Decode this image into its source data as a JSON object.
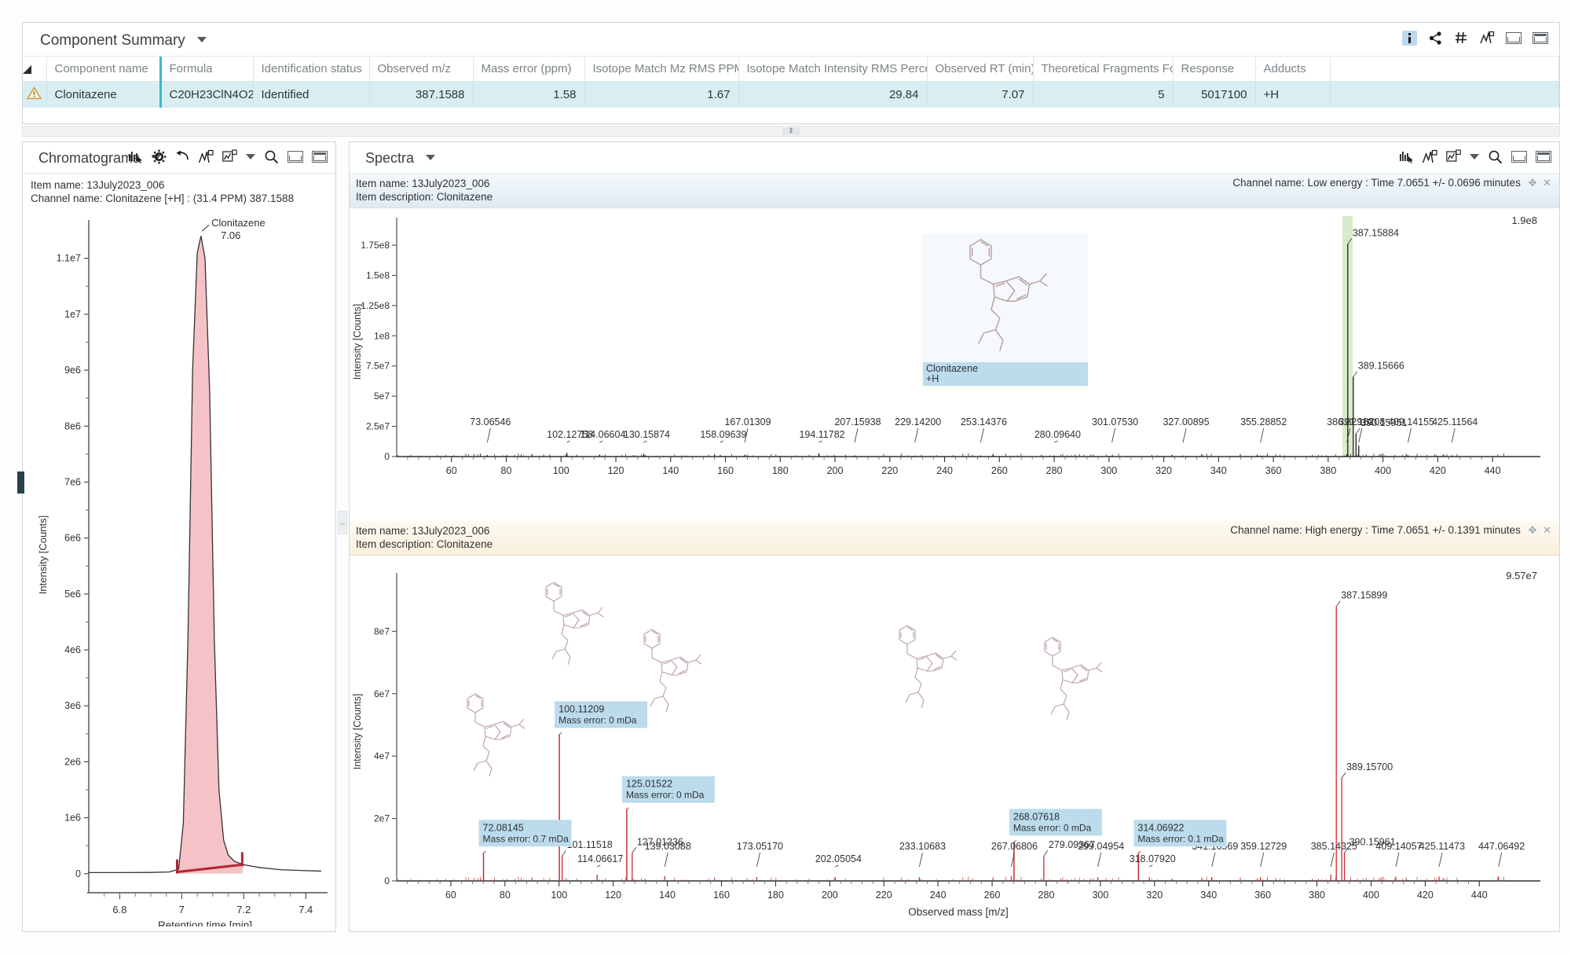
{
  "component_summary": {
    "title": "Component Summary",
    "columns": [
      {
        "label": "Component name",
        "align": "left"
      },
      {
        "label": "Formula",
        "align": "left"
      },
      {
        "label": "Identification status",
        "align": "left"
      },
      {
        "label": "Observed m/z",
        "align": "right"
      },
      {
        "label": "Mass error (ppm)",
        "align": "right"
      },
      {
        "label": "Isotope Match Mz RMS PPM",
        "align": "right"
      },
      {
        "label": "Isotope Match Intensity RMS Percent",
        "align": "right"
      },
      {
        "label": "Observed RT (min)",
        "align": "right"
      },
      {
        "label": "Theoretical Fragments Found",
        "align": "right"
      },
      {
        "label": "Response",
        "align": "right"
      },
      {
        "label": "Adducts",
        "align": "left"
      },
      {
        "label": "",
        "align": "left"
      }
    ],
    "rows": [
      {
        "component_name": "Clonitazene",
        "formula": "C20H23ClN4O2",
        "identification_status": "Identified",
        "observed_mz": "387.1588",
        "mass_error_ppm": "1.58",
        "isotope_match_mz_rms_ppm": "1.67",
        "isotope_match_intensity_rms_percent": "29.84",
        "observed_rt_min": "7.07",
        "theoretical_fragments_found": "5",
        "response": "5017100",
        "adducts": "+H",
        "extra": ""
      }
    ],
    "toolbar_icons": [
      "info-icon",
      "share-icon",
      "hash-icon",
      "peak-pick-icon",
      "restore-window-icon",
      "maximize-window-icon"
    ]
  },
  "chromatograms": {
    "title": "Chromatograms",
    "toolbar_icons": [
      "bar-pick-icon",
      "gear-icon",
      "undo-icon",
      "peak-annotate-icon",
      "chart-type-icon",
      "chevron-down-icon",
      "zoom-icon",
      "restore-window-icon",
      "maximize-window-icon"
    ],
    "item_name": "Item name: 13July2023_006",
    "channel_name": "Channel name: Clonitazene [+H] : (31.4 PPM) 387.1588",
    "peak_label": "Clonitazene",
    "peak_rt": "7.06",
    "chart_data": {
      "type": "line",
      "title": "Clonitazene [+H] : (31.4 PPM) 387.1588",
      "xlabel": "Retention time [min]",
      "ylabel": "Intensity [Counts]",
      "xlim": [
        6.7,
        7.45
      ],
      "ylim": [
        -200000,
        11600000
      ],
      "xticks": [
        "6.8",
        "7",
        "7.2",
        "7.4"
      ],
      "xtickvals": [
        6.8,
        7.0,
        7.2,
        7.4
      ],
      "yticks": [
        "0",
        "1e6",
        "2e6",
        "3e6",
        "4e6",
        "5e6",
        "6e6",
        "7e6",
        "8e6",
        "9e6",
        "1e7",
        "1.1e7"
      ],
      "ytickvals": [
        0,
        1000000,
        2000000,
        3000000,
        4000000,
        5000000,
        6000000,
        7000000,
        8000000,
        9000000,
        10000000,
        11000000
      ],
      "peak_apex_x": 7.06,
      "peak_apex_y": 11400000,
      "integration_start": 6.985,
      "integration_end": 7.195,
      "fill_color": "#f3b8bd",
      "line_color": "#333333",
      "baseline_color": "#b12732",
      "trace": [
        {
          "x": 6.7,
          "y": 20000
        },
        {
          "x": 6.8,
          "y": 20000
        },
        {
          "x": 6.9,
          "y": 22000
        },
        {
          "x": 6.96,
          "y": 30000
        },
        {
          "x": 6.99,
          "y": 80000
        },
        {
          "x": 7.005,
          "y": 900000
        },
        {
          "x": 7.02,
          "y": 4200000
        },
        {
          "x": 7.035,
          "y": 9000000
        },
        {
          "x": 7.05,
          "y": 11100000
        },
        {
          "x": 7.062,
          "y": 11400000
        },
        {
          "x": 7.075,
          "y": 11000000
        },
        {
          "x": 7.09,
          "y": 8600000
        },
        {
          "x": 7.105,
          "y": 4200000
        },
        {
          "x": 7.12,
          "y": 1500000
        },
        {
          "x": 7.135,
          "y": 600000
        },
        {
          "x": 7.15,
          "y": 330000
        },
        {
          "x": 7.17,
          "y": 220000
        },
        {
          "x": 7.2,
          "y": 160000
        },
        {
          "x": 7.25,
          "y": 110000
        },
        {
          "x": 7.32,
          "y": 70000
        },
        {
          "x": 7.45,
          "y": 45000
        }
      ]
    }
  },
  "spectra": {
    "title": "Spectra",
    "toolbar_icons": [
      "bar-pick-icon",
      "peak-annotate-icon",
      "chart-type-icon",
      "chevron-down-icon",
      "zoom-icon",
      "restore-window-icon",
      "maximize-window-icon"
    ],
    "low_energy": {
      "item_name": "Item name: 13July2023_006",
      "item_description": "Item description: Clonitazene",
      "channel_name": "Channel name: Low energy : Time 7.0651 +/- 0.0696 minutes",
      "max_intensity_label": "1.9e8",
      "structure_caption_name": "Clonitazene",
      "structure_caption_adduct": "+H",
      "highlight_color": "#d9ecc9",
      "chart_data": {
        "type": "bar",
        "xlabel": "",
        "ylabel": "Intensity [Counts]",
        "xlim": [
          40,
          450
        ],
        "ylim": [
          0,
          190000000
        ],
        "xticks": [
          "60",
          "80",
          "100",
          "120",
          "140",
          "160",
          "180",
          "200",
          "220",
          "240",
          "260",
          "280",
          "300",
          "320",
          "340",
          "360",
          "380",
          "400",
          "420",
          "440"
        ],
        "xtickvals": [
          60,
          80,
          100,
          120,
          140,
          160,
          180,
          200,
          220,
          240,
          260,
          280,
          300,
          320,
          340,
          360,
          380,
          400,
          420,
          440
        ],
        "yticks": [
          "0",
          "2.5e7",
          "5e7",
          "7.5e7",
          "1e8",
          "1.25e8",
          "1.5e8",
          "1.75e8"
        ],
        "ytickvals": [
          0,
          25000000,
          50000000,
          75000000,
          100000000,
          125000000,
          150000000,
          175000000
        ],
        "labeled_peaks": [
          {
            "mz": "73.06546",
            "x": 73.06546,
            "y": 1200000
          },
          {
            "mz": "102.12758",
            "x": 102.12758,
            "y": 3000000
          },
          {
            "mz": "114.06604",
            "x": 114.06604,
            "y": 1500000
          },
          {
            "mz": "130.15874",
            "x": 130.15874,
            "y": 2400000
          },
          {
            "mz": "158.09639",
            "x": 158.09639,
            "y": 1200000
          },
          {
            "mz": "167.01309",
            "x": 167.01309,
            "y": 1400000
          },
          {
            "mz": "194.11782",
            "x": 194.11782,
            "y": 2600000
          },
          {
            "mz": "207.15938",
            "x": 207.15938,
            "y": 900000
          },
          {
            "mz": "229.14200",
            "x": 229.142,
            "y": 800000
          },
          {
            "mz": "253.14376",
            "x": 253.14376,
            "y": 900000
          },
          {
            "mz": "280.09640",
            "x": 280.0964,
            "y": 900000
          },
          {
            "mz": "301.07530",
            "x": 301.0753,
            "y": 800000
          },
          {
            "mz": "327.00895",
            "x": 327.00895,
            "y": 800000
          },
          {
            "mz": "355.28852",
            "x": 355.28852,
            "y": 800000
          },
          {
            "mz": "386.82910",
            "x": 386.8291,
            "y": 2000000
          },
          {
            "mz": "387.15884",
            "x": 387.15884,
            "y": 176000000
          },
          {
            "mz": "389.15666",
            "x": 389.15666,
            "y": 66000000
          },
          {
            "mz": "390.15951",
            "x": 390.15951,
            "y": 19000000
          },
          {
            "mz": "391.16208",
            "x": 391.16208,
            "y": 9000000
          },
          {
            "mz": "409.14155",
            "x": 409.14155,
            "y": 1000000
          },
          {
            "mz": "425.11564",
            "x": 425.11564,
            "y": 1000000
          }
        ],
        "highlight_band": {
          "from": 385.2,
          "to": 389.0
        }
      }
    },
    "high_energy": {
      "item_name": "Item name: 13July2023_006",
      "item_description": "Item description: Clonitazene",
      "channel_name": "Channel name: High energy : Time 7.0651 +/- 0.1391 minutes",
      "max_intensity_label": "9.57e7",
      "chart_data": {
        "type": "bar",
        "xlabel": "Observed mass [m/z]",
        "ylabel": "Intensity [Counts]",
        "xlim": [
          40,
          455
        ],
        "ylim": [
          0,
          95700000
        ],
        "xticks": [
          "60",
          "80",
          "100",
          "120",
          "140",
          "160",
          "180",
          "200",
          "220",
          "240",
          "260",
          "280",
          "300",
          "320",
          "340",
          "360",
          "380",
          "400",
          "420",
          "440"
        ],
        "xtickvals": [
          60,
          80,
          100,
          120,
          140,
          160,
          180,
          200,
          220,
          240,
          260,
          280,
          300,
          320,
          340,
          360,
          380,
          400,
          420,
          440
        ],
        "yticks": [
          "0",
          "2e7",
          "4e7",
          "6e7",
          "8e7"
        ],
        "ytickvals": [
          0,
          20000000,
          40000000,
          60000000,
          80000000
        ],
        "annotated_fragments": [
          {
            "mz": "72.08145",
            "x": 72.08145,
            "y": 9000000,
            "mass_error": "Mass error: 0.7 mDa"
          },
          {
            "mz": "100.11209",
            "x": 100.11209,
            "y": 47000000,
            "mass_error": "Mass error: 0 mDa"
          },
          {
            "mz": "125.01522",
            "x": 125.01522,
            "y": 23000000,
            "mass_error": "Mass error: 0 mDa"
          },
          {
            "mz": "268.07618",
            "x": 268.07618,
            "y": 12500000,
            "mass_error": "Mass error: 0 mDa"
          },
          {
            "mz": "314.06922",
            "x": 314.06922,
            "y": 9000000,
            "mass_error": "Mass error: 0.1 mDa"
          }
        ],
        "labeled_peaks": [
          {
            "mz": "101.11518",
            "x": 101.11518,
            "y": 8000000
          },
          {
            "mz": "114.06617",
            "x": 114.06617,
            "y": 2000000
          },
          {
            "mz": "127.01236",
            "x": 127.01236,
            "y": 9000000
          },
          {
            "mz": "139.03088",
            "x": 139.03088,
            "y": 1500000
          },
          {
            "mz": "173.05170",
            "x": 173.0517,
            "y": 1200000
          },
          {
            "mz": "202.05054",
            "x": 202.05054,
            "y": 1200000
          },
          {
            "mz": "233.10683",
            "x": 233.10683,
            "y": 1200000
          },
          {
            "mz": "267.06806",
            "x": 267.06806,
            "y": 1600000
          },
          {
            "mz": "279.09367",
            "x": 279.09367,
            "y": 8000000
          },
          {
            "mz": "299.04954",
            "x": 299.04954,
            "y": 1200000
          },
          {
            "mz": "318.07920",
            "x": 318.0792,
            "y": 1200000
          },
          {
            "mz": "341.16569",
            "x": 341.16569,
            "y": 1200000
          },
          {
            "mz": "359.12729",
            "x": 359.12729,
            "y": 1200000
          },
          {
            "mz": "385.14325",
            "x": 385.14325,
            "y": 2000000
          },
          {
            "mz": "387.15899",
            "x": 387.15899,
            "y": 88000000
          },
          {
            "mz": "389.15700",
            "x": 389.157,
            "y": 33000000
          },
          {
            "mz": "390.15961",
            "x": 390.15961,
            "y": 9000000
          },
          {
            "mz": "409.14057",
            "x": 409.14057,
            "y": 1400000
          },
          {
            "mz": "425.11473",
            "x": 425.11473,
            "y": 1400000
          },
          {
            "mz": "447.06492",
            "x": 447.06492,
            "y": 1400000
          }
        ]
      }
    }
  },
  "colors": {
    "row_selected": "#d8eef2",
    "accent_teal": "#3fb8c8",
    "chromatogram_fill": "#f3b8bd",
    "chromatogram_baseline": "#b12732",
    "spectrum_high_energy_line": "#cc2b2b",
    "annotation_bg": "#bcdcec",
    "highlight_green": "#d9ecc9"
  }
}
